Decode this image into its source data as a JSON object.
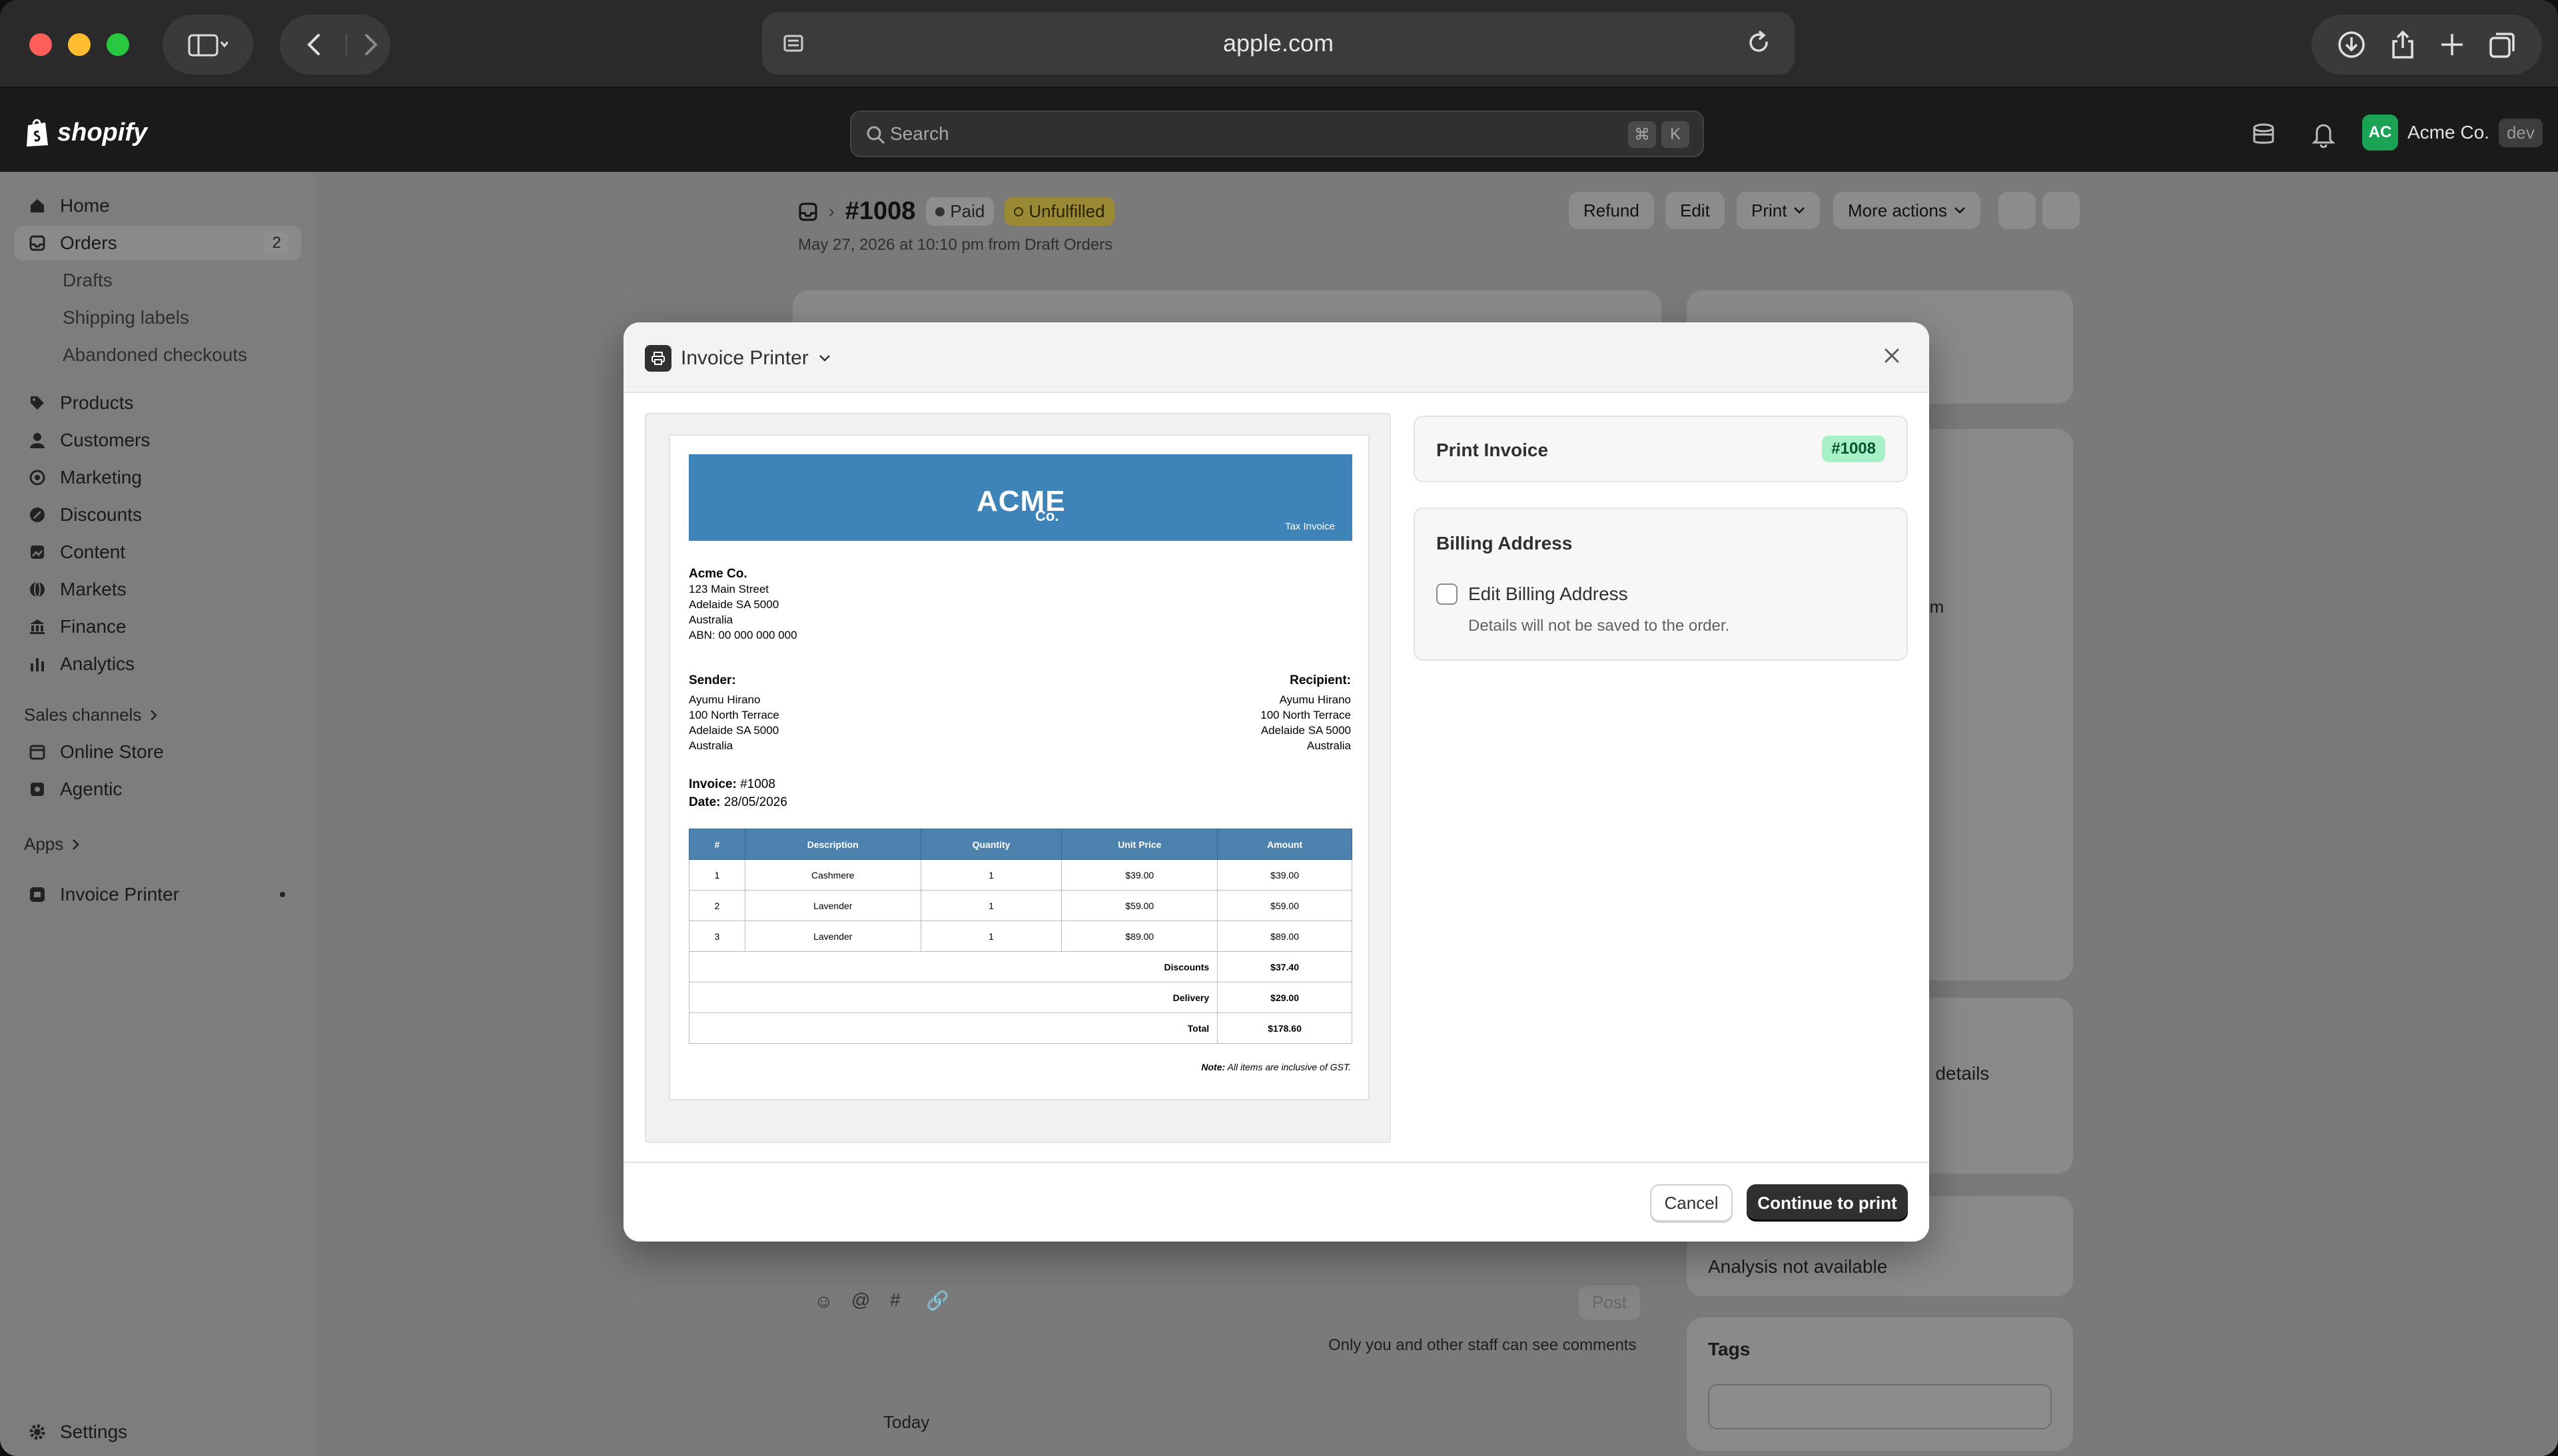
{
  "browser": {
    "url": "apple.com"
  },
  "shopify": {
    "brand": "shopify",
    "search_placeholder": "Search",
    "shortcut_keys": [
      "⌘",
      "K"
    ],
    "account_initials": "AC",
    "account_name": "Acme Co.",
    "account_tag": "dev"
  },
  "sidebar": {
    "items": [
      {
        "label": "Home",
        "icon": "home-icon"
      },
      {
        "label": "Orders",
        "icon": "inbox-icon",
        "count": "2"
      },
      {
        "label": "Drafts"
      },
      {
        "label": "Shipping labels"
      },
      {
        "label": "Abandoned checkouts"
      },
      {
        "label": "Products",
        "icon": "tag-icon"
      },
      {
        "label": "Customers",
        "icon": "person-icon"
      },
      {
        "label": "Marketing",
        "icon": "target-icon"
      },
      {
        "label": "Discounts",
        "icon": "discount-icon"
      },
      {
        "label": "Content",
        "icon": "content-icon"
      },
      {
        "label": "Markets",
        "icon": "globe-icon"
      },
      {
        "label": "Finance",
        "icon": "bank-icon"
      },
      {
        "label": "Analytics",
        "icon": "bar-chart-icon"
      }
    ],
    "sales_channels_label": "Sales channels",
    "channels": [
      {
        "label": "Online Store"
      },
      {
        "label": "Agentic"
      }
    ],
    "apps_label": "Apps",
    "apps": [
      {
        "label": "Invoice Printer"
      }
    ],
    "settings_label": "Settings"
  },
  "order": {
    "number": "#1008",
    "payment_status": "Paid",
    "fulfillment_status": "Unfulfilled",
    "subtitle": "May 27, 2026 at 10:10 pm from Draft Orders",
    "actions": [
      "Refund",
      "Edit",
      "Print",
      "More actions"
    ],
    "background_texts": {
      "analysis": "Analysis not available",
      "tags_label": "Tags",
      "comments_note": "Only you and other staff can see comments",
      "post_label": "Post",
      "today_label": "Today",
      "details_fragment": "n details",
      "om_fragment": "om"
    }
  },
  "modal": {
    "title": "Invoice Printer",
    "print_invoice_label": "Print Invoice",
    "order_tag": "#1008",
    "billing_title": "Billing Address",
    "edit_billing_label": "Edit Billing Address",
    "edit_billing_help": "Details will not be saved to the order.",
    "cancel_label": "Cancel",
    "continue_label": "Continue to print"
  },
  "invoice": {
    "logo_main": "ACME",
    "logo_sub": "Co.",
    "doc_type": "Tax Invoice",
    "company": {
      "name": "Acme Co.",
      "lines": [
        "123 Main Street",
        "Adelaide SA 5000",
        "Australia",
        "ABN: 00 000 000 000"
      ]
    },
    "sender_label": "Sender:",
    "sender": [
      "Ayumu Hirano",
      "100 North Terrace",
      "Adelaide SA 5000",
      "Australia"
    ],
    "recipient_label": "Recipient:",
    "recipient": [
      "Ayumu Hirano",
      "100 North Terrace",
      "Adelaide SA 5000",
      "Australia"
    ],
    "invoice_label": "Invoice:",
    "invoice_no": "#1008",
    "date_label": "Date:",
    "date": "28/05/2026",
    "columns": [
      "#",
      "Description",
      "Quantity",
      "Unit Price",
      "Amount"
    ],
    "rows": [
      [
        "1",
        "Cashmere",
        "1",
        "$39.00",
        "$39.00"
      ],
      [
        "2",
        "Lavender",
        "1",
        "$59.00",
        "$59.00"
      ],
      [
        "3",
        "Lavender",
        "1",
        "$89.00",
        "$89.00"
      ]
    ],
    "totals": [
      {
        "label": "Discounts",
        "value": "$37.40"
      },
      {
        "label": "Delivery",
        "value": "$29.00"
      },
      {
        "label": "Total",
        "value": "$178.60"
      }
    ],
    "note_label": "Note:",
    "note_text": "All items are inclusive of GST."
  }
}
